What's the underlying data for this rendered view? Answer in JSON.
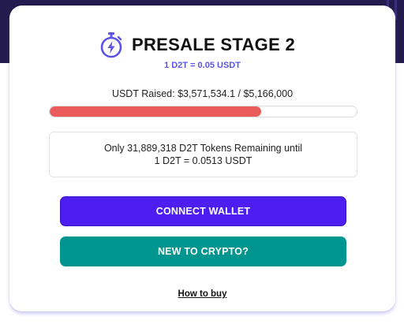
{
  "header": {
    "icon": "stopwatch-lightning-icon",
    "title": "PRESALE STAGE 2",
    "rate": "1 D2T = 0.05 USDT"
  },
  "raised": {
    "text": "USDT Raised: $3,571,534.1 / $5,166,000",
    "progress_fraction": 0.69
  },
  "remaining": {
    "line1": "Only 31,889,318 D2T Tokens Remaining until",
    "line2": "1 D2T = 0.0513 USDT"
  },
  "buttons": {
    "connect_label": "CONNECT WALLET",
    "new_label": "NEW TO CRYPTO?"
  },
  "links": {
    "how_to_buy": "How to buy"
  },
  "colors": {
    "accent_purple": "#4c1ff0",
    "accent_teal": "#00968f",
    "progress_red": "#ea5c5c",
    "rate_blue": "#5d53e8",
    "background_dark": "#231a4d"
  }
}
